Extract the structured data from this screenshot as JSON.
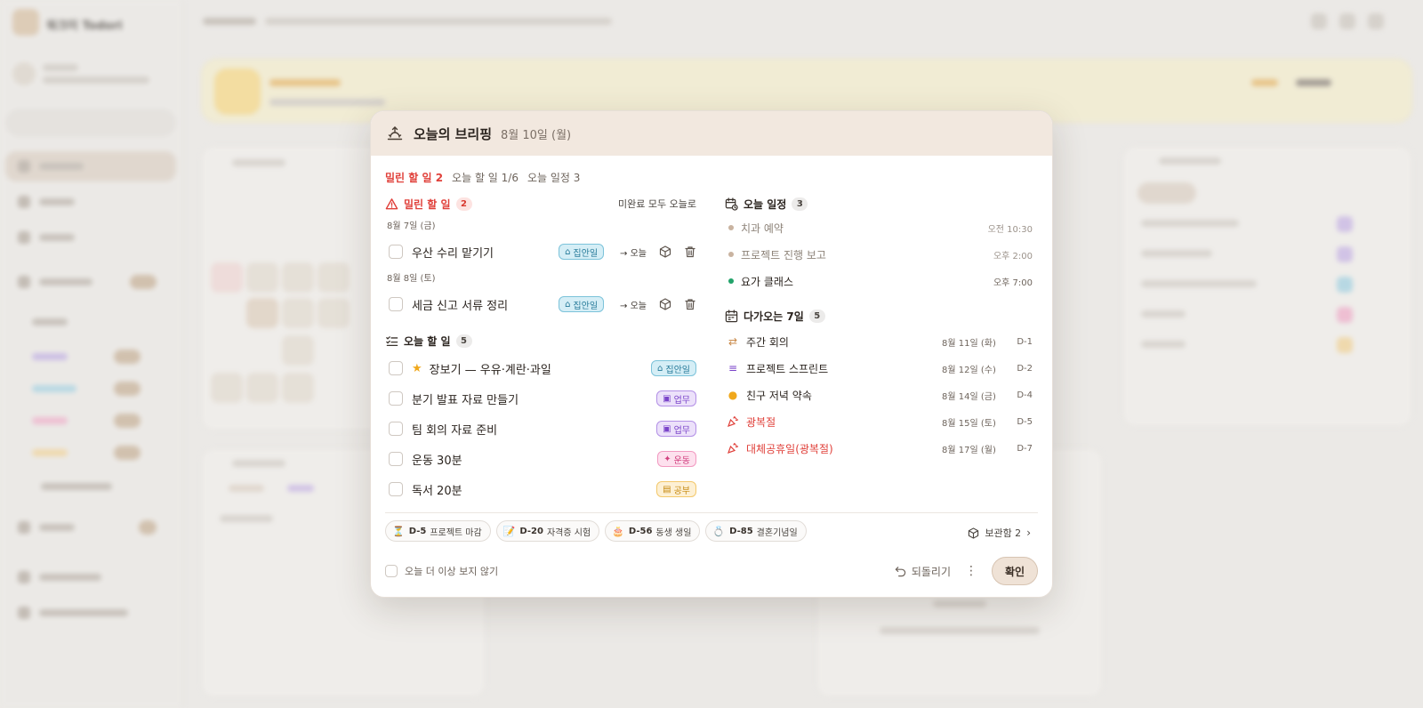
{
  "app": {
    "name": "워크미 Todori"
  },
  "briefing": {
    "title": "오늘의 브리핑",
    "date": "8월 10일 (월)",
    "summary": {
      "overdue": "밀린 할 일 2",
      "today": "오늘 할 일 1/6",
      "schedule": "오늘 일정 3"
    }
  },
  "overdue": {
    "heading": "밀린 할 일",
    "count": "2",
    "action": "미완료 모두 오늘로",
    "groups": [
      {
        "date": "8월 7일 (금)",
        "task": {
          "title": "우산 수리 맡기기",
          "tag": "집안일",
          "move": "→ 오늘"
        }
      },
      {
        "date": "8월 8일 (토)",
        "task": {
          "title": "세금 신고 서류 정리",
          "tag": "집안일",
          "move": "→ 오늘"
        }
      }
    ]
  },
  "today_tasks": {
    "heading": "오늘 할 일",
    "count": "5",
    "items": [
      {
        "title": "장보기 — 우유·계란·과일",
        "tag": "집안일",
        "starred": true
      },
      {
        "title": "분기 발표 자료 만들기",
        "tag": "업무"
      },
      {
        "title": "팀 회의 자료 준비",
        "tag": "업무"
      },
      {
        "title": "운동 30분",
        "tag": "운동"
      },
      {
        "title": "독서 20분",
        "tag": "공부"
      }
    ]
  },
  "today_schedule": {
    "heading": "오늘 일정",
    "count": "3",
    "items": [
      {
        "name": "치과 예약",
        "time": "오전 10:30",
        "color": "#c9b3a0"
      },
      {
        "name": "프로젝트 진행 보고",
        "time": "오후 2:00",
        "color": "#c9b3a0"
      },
      {
        "name": "요가 클래스",
        "time": "오후 7:00",
        "color": "#22a36a"
      }
    ]
  },
  "upcoming": {
    "heading": "다가오는 7일",
    "count": "5",
    "items": [
      {
        "name": "주간 회의",
        "date": "8월 11일 (화)",
        "dday": "D-1",
        "icon": "repeat-icon"
      },
      {
        "name": "프로젝트 스프린트",
        "date": "8월 12일 (수)",
        "dday": "D-2",
        "icon": "sprint-icon"
      },
      {
        "name": "친구 저녁 약속",
        "date": "8월 14일 (금)",
        "dday": "D-4",
        "icon": "dot-icon"
      },
      {
        "name": "광복절",
        "date": "8월 15일 (토)",
        "dday": "D-5",
        "icon": "party-icon"
      },
      {
        "name": "대체공휴일(광복절)",
        "date": "8월 17일 (월)",
        "dday": "D-7",
        "icon": "party-icon"
      }
    ]
  },
  "ddays": [
    {
      "d": "D-5",
      "label": "프로젝트 마감",
      "icon": "⏳"
    },
    {
      "d": "D-20",
      "label": "자격증 시험",
      "icon": "📝"
    },
    {
      "d": "D-56",
      "label": "동생 생일",
      "icon": "🎂"
    },
    {
      "d": "D-85",
      "label": "결혼기념일",
      "icon": "💍"
    }
  ],
  "archive": {
    "label": "보관함 2"
  },
  "footer": {
    "hide_today": "오늘 더 이상 보지 않기",
    "undo": "되돌리기",
    "confirm": "확인"
  },
  "colors": {
    "accent": "#f2e8df",
    "overdue": "#e0403a",
    "home": "#267a99",
    "work": "#7a43c9",
    "sport": "#d1407f",
    "study": "#c68a12"
  }
}
